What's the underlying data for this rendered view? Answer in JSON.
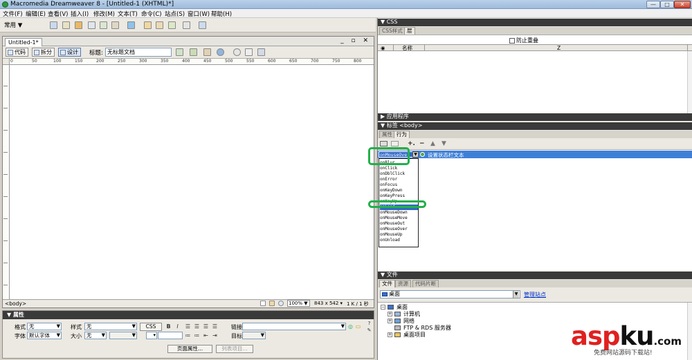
{
  "window": {
    "title": "Macromedia Dreamweaver 8 - [Untitled-1 (XHTML)*]",
    "minimize": "—",
    "maximize": "□",
    "close": "✕"
  },
  "menu": [
    "文件(F)",
    "编辑(E)",
    "查看(V)",
    "插入(I)",
    "修改(M)",
    "文本(T)",
    "命令(C)",
    "站点(S)",
    "窗口(W)",
    "帮助(H)"
  ],
  "insert_bar": {
    "category": "常用 ▼"
  },
  "document": {
    "tab": "Untitled-1*",
    "window_buttons": "_ ▫ ✕",
    "view_code": "代码",
    "view_split": "拆分",
    "view_design": "设计",
    "title_label": "标题:",
    "title_value": "无标题文档",
    "ruler_ticks": [
      "0",
      "50",
      "100",
      "150",
      "200",
      "250",
      "300",
      "350",
      "400",
      "450",
      "500",
      "550",
      "600",
      "650",
      "700",
      "750",
      "800"
    ],
    "status_tag": "<body>",
    "zoom": "100% ▼",
    "window_size": "843 x 542 ▾",
    "download_size": "1 K / 1 秒"
  },
  "properties": {
    "header": "▼ 属性",
    "format_label": "格式",
    "format_value": "无",
    "style_label": "样式",
    "style_value": "无",
    "css_button": "CSS",
    "bold": "B",
    "italic": "I",
    "link_label": "链接",
    "font_label": "字体",
    "font_value": "默认字体",
    "size_label": "大小",
    "size_value": "无",
    "target_label": "目标",
    "page_props_button": "页面属性...",
    "list_item_button": "列表项目..."
  },
  "css_panel": {
    "header": "▼ CSS",
    "tab_styles": "CSS样式",
    "tab_layers": "层",
    "prevent_overlap": "防止重叠",
    "col_name": "名称",
    "col_z": "Z"
  },
  "app_panel": {
    "header": "▶ 应用程序"
  },
  "tag_panel": {
    "header": "▼ 标签 <body>",
    "tab_attributes": "属性",
    "tab_behaviors": "行为",
    "selected_event": "onMouseOver",
    "action": "设置状态栏文本",
    "events": [
      "onBlur",
      "onClick",
      "onDblClick",
      "onError",
      "onFocus",
      "onKeyDown",
      "onKeyPress",
      "onKeyUp",
      "onLoad",
      "onMouseDown",
      "onMouseMove",
      "onMouseOut",
      "onMouseOver",
      "onMouseUp",
      "onUnload"
    ],
    "highlighted_event": "onLoad"
  },
  "files_panel": {
    "header": "▼ 文件",
    "tab_files": "文件",
    "tab_assets": "资源",
    "tab_snippets": "代码片断",
    "site": "桌面",
    "manage_sites": "管理站点",
    "tree": [
      "桌面",
      "计算机",
      "网络",
      "FTP & RDS 服务器",
      "桌面项目"
    ]
  },
  "watermark": {
    "logo_a": "asp",
    "logo_b": "ku",
    "logo_c": ".com",
    "tagline": "免费网站源码下载站!"
  },
  "colors": {
    "selection": "#3168c6",
    "highlight_ring": "#22b04a",
    "panel_header": "#3a3a3a",
    "watermark_red": "#e02020"
  }
}
